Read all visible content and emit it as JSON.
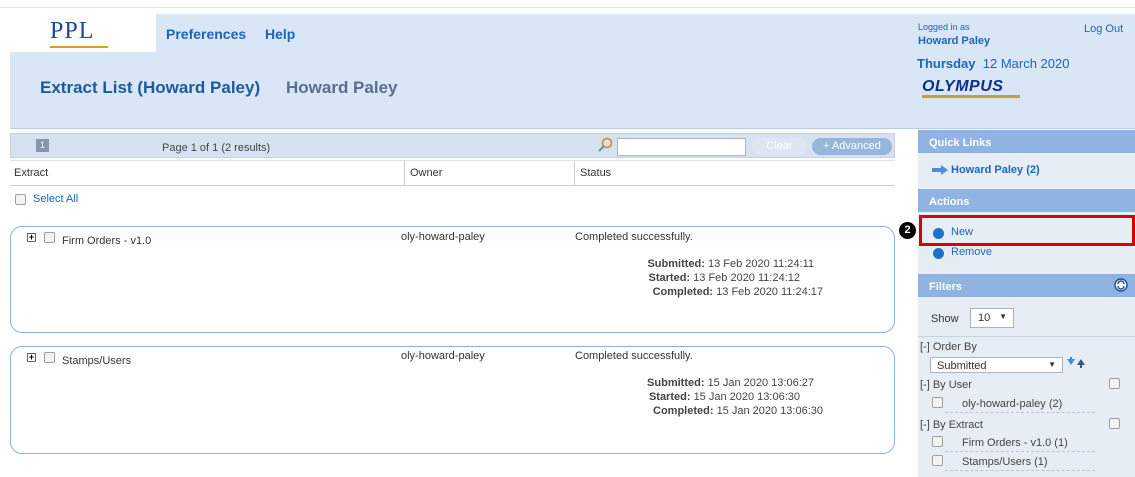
{
  "app": {
    "logo": "PPL"
  },
  "nav": {
    "preferences": "Preferences",
    "help": "Help"
  },
  "page": {
    "title_main": "Extract List (Howard Paley)",
    "title_sub": "Howard Paley"
  },
  "user": {
    "logged_in_label": "Logged in as",
    "name": "Howard Paley",
    "logout": "Log Out"
  },
  "date": {
    "day": "Thursday",
    "date": "12 March 2020"
  },
  "brand": {
    "name": "OLYMPUS"
  },
  "pager": {
    "page_button": "1",
    "page_text": "Page 1 of 1 (2 results)"
  },
  "search": {
    "placeholder": "",
    "value": "",
    "clear_label": "Clear",
    "advanced_label": "+ Advanced"
  },
  "table": {
    "columns": [
      "Extract",
      "Owner",
      "Status"
    ],
    "select_all": "Select All",
    "rows": [
      {
        "name": "Firm Orders - v1.0",
        "owner": "oly-howard-paley",
        "status": "Completed successfully.",
        "submitted_label": "Submitted:",
        "submitted": "13 Feb 2020 11:24:11",
        "started_label": "Started:",
        "started": "13 Feb 2020 11:24:12",
        "completed_label": "Completed:",
        "completed": "13 Feb 2020 11:24:17"
      },
      {
        "name": "Stamps/Users",
        "owner": "oly-howard-paley",
        "status": "Completed successfully.",
        "submitted_label": "Submitted:",
        "submitted": "15 Jan 2020 13:06:27",
        "started_label": "Started:",
        "started": "15 Jan 2020 13:06:30",
        "completed_label": "Completed:",
        "completed": "15 Jan 2020 13:06:30"
      }
    ]
  },
  "sidebar": {
    "quick_links_title": "Quick Links",
    "quick_link": "Howard Paley (2)",
    "actions_title": "Actions",
    "action_new": "New",
    "action_remove": "Remove",
    "annotation_badge": "2",
    "filters_title": "Filters",
    "show_label": "Show",
    "show_value": "10",
    "order_by_label": "[-] Order By",
    "order_by_value": "Submitted",
    "by_user_label": "[-] By User",
    "user_item": "oly-howard-paley (2)",
    "by_extract_label": "[-] By Extract",
    "extract_items": [
      "Firm Orders - v1.0 (1)",
      "Stamps/Users (1)"
    ]
  },
  "colors": {
    "accent": "#1c66b8",
    "header_bg": "#d8e6f6",
    "sidebar_head": "#8fb4e2",
    "highlight": "#d90000"
  }
}
